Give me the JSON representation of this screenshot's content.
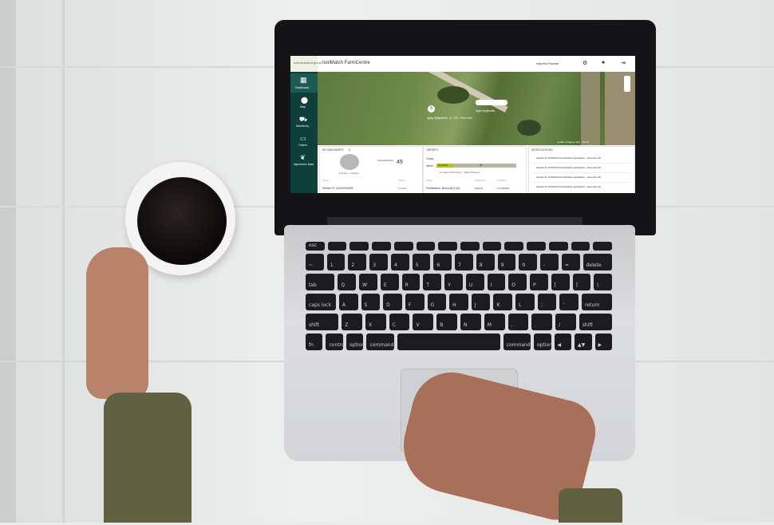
{
  "app": {
    "brand": "overseasland group",
    "title": "toolMatch FarmCentre",
    "user": "Harvest Planner"
  },
  "sidebar": [
    {
      "label": "Dashboard",
      "icon": "dashboard-icon"
    },
    {
      "label": "Map",
      "icon": "map-pin-icon"
    },
    {
      "label": "Machinery",
      "icon": "tractor-icon"
    },
    {
      "label": "Orders",
      "icon": "calendar-icon"
    },
    {
      "label": "Agronomic Data",
      "icon": "plant-icon"
    }
  ],
  "map": {
    "pin_label": "3",
    "field_label": "Agri-ingitsulfa",
    "caption": "Agrip Spigelland - 5 - 3/3 - Farm Cen",
    "footer": "Leaflet | Imagery: Esri - Terms"
  },
  "panels": {
    "machines": {
      "title": "MY MACHINERY",
      "count": "6",
      "donut_value": "49",
      "donut_label": "Total Machines",
      "legend": "● Active  ○ Inactive",
      "col1": "Name",
      "col2": "Status",
      "row_name": "Seeder FL 4444VRAN06",
      "row_status": "● Active"
    },
    "orders": {
      "title": "ORDER",
      "count": "3",
      "row1": "Today",
      "row2_label": "Week",
      "bar_value_a": "44 (62%)",
      "bar_value_b": "38",
      "bar_fill_fraction": 0.21,
      "legend": "● Orders Performed  ○ Tasks Planned",
      "col1": "Name",
      "col2": "Machinery",
      "col3": "Deadline",
      "row_name": "Fertilization, Broccoli (3 ha)",
      "row_machine": "Seed 8",
      "row_deadline": "17/10/2018"
    },
    "notifications": {
      "title": "NOTIFICATIONS",
      "items": [
        "Seeder FL 4444VRAN Fertilization application - document ID",
        "Seeder FL 4444VRAN Fertilization application - document ID",
        "Seeder FL 4444VRAN Fertilization application - document ID",
        "Seeder FL 4444VRAN Fertilization application - document ID"
      ]
    }
  },
  "keyboard": {
    "rows": [
      [
        "esc",
        "",
        "",
        "",
        "",
        "",
        "",
        "",
        "",
        "",
        "",
        "",
        "",
        ""
      ],
      [
        "~",
        "1",
        "2",
        "3",
        "4",
        "5",
        "6",
        "7",
        "8",
        "9",
        "0",
        "-",
        "=",
        "delete"
      ],
      [
        "tab",
        "Q",
        "W",
        "E",
        "R",
        "T",
        "Y",
        "U",
        "I",
        "O",
        "P",
        "[",
        "]",
        "\\"
      ],
      [
        "caps lock",
        "A",
        "S",
        "D",
        "F",
        "G",
        "H",
        "J",
        "K",
        "L",
        ";",
        "'",
        "return"
      ],
      [
        "shift",
        "Z",
        "X",
        "C",
        "V",
        "B",
        "N",
        "M",
        ",",
        ".",
        "/",
        "shift"
      ],
      [
        "fn",
        "control",
        "option",
        "command",
        "",
        "command",
        "option",
        "◀",
        "▲▼",
        "▶"
      ]
    ]
  }
}
